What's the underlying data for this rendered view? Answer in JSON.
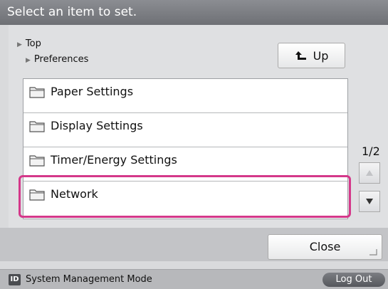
{
  "header": {
    "title": "Select an item to set."
  },
  "breadcrumb": {
    "items": [
      "Top",
      "Preferences"
    ]
  },
  "nav": {
    "up_label": "Up"
  },
  "list": {
    "items": [
      {
        "label": "Paper Settings",
        "icon": "folder-icon"
      },
      {
        "label": "Display Settings",
        "icon": "folder-icon"
      },
      {
        "label": "Timer/Energy Settings",
        "icon": "folder-icon"
      },
      {
        "label": "Network",
        "icon": "folder-icon",
        "highlighted": true
      }
    ]
  },
  "pager": {
    "indicator": "1/2",
    "up_enabled": false,
    "down_enabled": true
  },
  "footer": {
    "close_label": "Close"
  },
  "status": {
    "id_badge": "ID",
    "mode_text": "System Management Mode",
    "logout_label": "Log Out"
  },
  "colors": {
    "highlight": "#d4388a",
    "header": "#7b7d82"
  }
}
